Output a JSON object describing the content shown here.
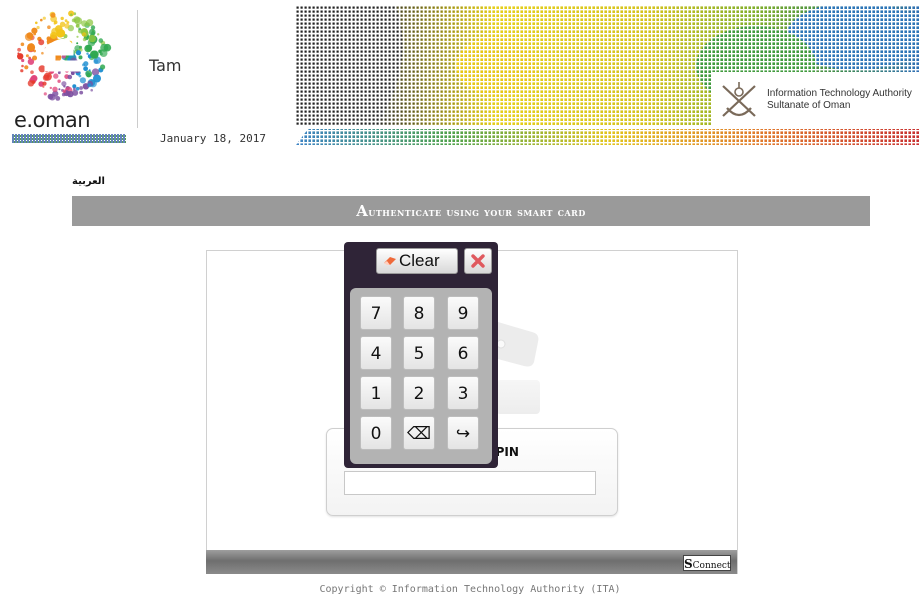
{
  "header": {
    "logo_text": "e.oman",
    "user_name": "Tam",
    "date": "January 18, 2017",
    "authority_line1": "Information Technology Authority",
    "authority_line2": "Sultanate of Oman"
  },
  "language_link": "العربية",
  "title_bar": {
    "first_letter": "A",
    "rest": "uthenticate using your smart card"
  },
  "pin_prompt": {
    "label": "ur PIN",
    "value": ""
  },
  "keypad": {
    "clear_label": "Clear",
    "keys": [
      "7",
      "8",
      "9",
      "4",
      "5",
      "6",
      "1",
      "2",
      "3",
      "0",
      "⌫",
      "↪"
    ]
  },
  "connect_button": {
    "letter": "S",
    "rest": "Connect"
  },
  "footer": {
    "copyright": "Copyright © Information Technology Authority (ITA)"
  },
  "colors": {
    "title_bar": "#9a9a9a",
    "keypad_frame": "#2f2437",
    "keypad_inner": "#b3b3b3",
    "close_icon": "#e0595e"
  },
  "icons": {
    "keypad_clear": "eraser-icon",
    "keypad_close": "close-icon",
    "authority": "emblem-icon"
  }
}
